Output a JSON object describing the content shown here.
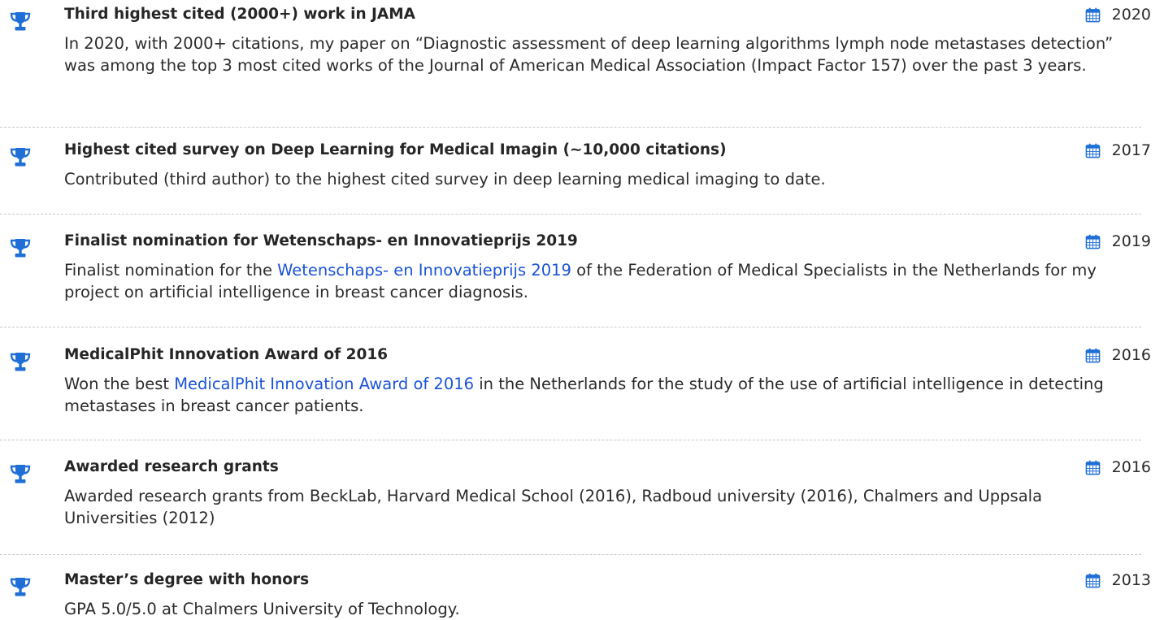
{
  "colors": {
    "icon_blue": "#1f6fd6",
    "link_blue": "#1a53d6",
    "text": "#2b2b2b",
    "separator": "#c9c9c9"
  },
  "icons": {
    "award": "trophy-icon",
    "date": "calendar-icon"
  },
  "awards": [
    {
      "title": "Third highest cited (2000+) work in JAMA",
      "year": "2020",
      "desc_before": "In 2020, with 2000+ citations, my paper on “Diagnostic assessment of deep learning algorithms lymph node metastases detection” was among the top 3 most cited works of the Journal of American Medical Association (Impact Factor 157) over the past 3 years.",
      "desc_link": "",
      "desc_after": ""
    },
    {
      "title": "Highest cited survey on Deep Learning for Medical Imagin (∼10,000 citations)",
      "year": "2017",
      "desc_before": "Contributed (third author) to the highest cited survey in deep learning medical imaging to date.",
      "desc_link": "",
      "desc_after": ""
    },
    {
      "title": "Finalist nomination for Wetenschaps- en Innovatieprijs 2019",
      "year": "2019",
      "desc_before": "Finalist nomination for the ",
      "desc_link": "Wetenschaps- en Innovatieprijs 2019",
      "desc_after": " of the Federation of Medical Specialists in the Netherlands for my project on artificial intelligence in breast cancer diagnosis."
    },
    {
      "title": "MedicalPhit Innovation Award of 2016",
      "year": "2016",
      "desc_before": "Won the best ",
      "desc_link": "MedicalPhit Innovation Award of 2016",
      "desc_after": " in the Netherlands for the study of the use of artificial intelligence in detecting metastases in breast cancer patients."
    },
    {
      "title": "Awarded research grants",
      "year": "2016",
      "desc_before": "Awarded research grants from BeckLab, Harvard Medical School (2016), Radboud university (2016), Chalmers and Uppsala Universities (2012)",
      "desc_link": "",
      "desc_after": ""
    },
    {
      "title": "Master’s degree with honors",
      "year": "2013",
      "desc_before": "GPA 5.0/5.0 at Chalmers University of Technology.",
      "desc_link": "",
      "desc_after": ""
    }
  ]
}
